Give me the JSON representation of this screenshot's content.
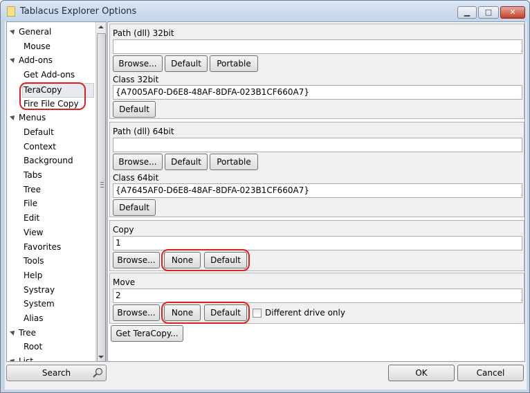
{
  "window": {
    "title": "Tablacus Explorer Options",
    "min_glyph": "▁",
    "max_glyph": "□",
    "close_glyph": "✕"
  },
  "tree": {
    "items": [
      {
        "label": "General",
        "level": 0,
        "expanded": true
      },
      {
        "label": "Mouse",
        "level": 1
      },
      {
        "label": "Add-ons",
        "level": 0,
        "expanded": true
      },
      {
        "label": "Get Add-ons",
        "level": 1
      },
      {
        "label": "TeraCopy",
        "level": 1,
        "selected": true
      },
      {
        "label": "Fire File Copy",
        "level": 1
      },
      {
        "label": "Menus",
        "level": 0,
        "expanded": true
      },
      {
        "label": "Default",
        "level": 1
      },
      {
        "label": "Context",
        "level": 1
      },
      {
        "label": "Background",
        "level": 1
      },
      {
        "label": "Tabs",
        "level": 1
      },
      {
        "label": "Tree",
        "level": 1
      },
      {
        "label": "File",
        "level": 1
      },
      {
        "label": "Edit",
        "level": 1
      },
      {
        "label": "View",
        "level": 1
      },
      {
        "label": "Favorites",
        "level": 1
      },
      {
        "label": "Tools",
        "level": 1
      },
      {
        "label": "Help",
        "level": 1
      },
      {
        "label": "Systray",
        "level": 1
      },
      {
        "label": "System",
        "level": 1
      },
      {
        "label": "Alias",
        "level": 1
      },
      {
        "label": "Tree",
        "level": 0,
        "expanded": true
      },
      {
        "label": "Root",
        "level": 1
      },
      {
        "label": "List",
        "level": 0,
        "expanded": true
      }
    ]
  },
  "sections": {
    "path32": {
      "label": "Path (dll) 32bit",
      "value": ""
    },
    "class32": {
      "label": "Class 32bit",
      "value": "{A7005AF0-D6E8-48AF-8DFA-023B1CF660A7}"
    },
    "path64": {
      "label": "Path (dll) 64bit",
      "value": ""
    },
    "class64": {
      "label": "Class 64bit",
      "value": "{A7645AF0-D6E8-48AF-8DFA-023B1CF660A7}"
    },
    "copy": {
      "label": "Copy",
      "value": "1"
    },
    "move": {
      "label": "Move",
      "value": "2",
      "different_drive_label": "Different drive only",
      "different_drive_checked": false
    }
  },
  "buttons": {
    "browse": "Browse...",
    "default": "Default",
    "portable": "Portable",
    "none": "None",
    "get_teracopy": "Get TeraCopy..."
  },
  "footer": {
    "search": "Search",
    "ok": "OK",
    "cancel": "Cancel"
  },
  "colors": {
    "highlight_ring": "#e02020"
  }
}
